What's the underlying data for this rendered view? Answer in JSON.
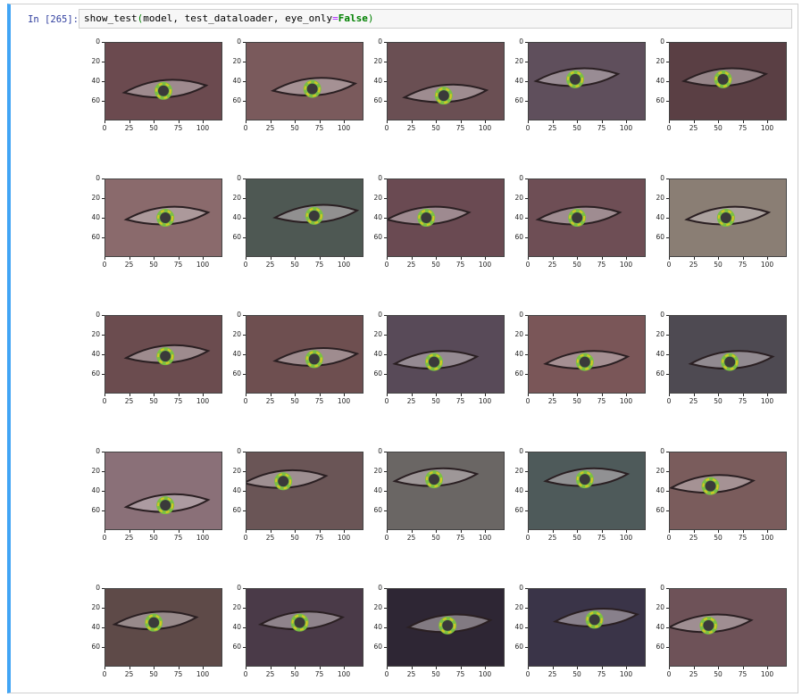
{
  "cell": {
    "prompt": "In [265]:",
    "code": {
      "fn": "show_test",
      "open": "(",
      "args": "model, test_dataloader, eye_only",
      "eq": "=",
      "kw": "False",
      "close": ")"
    }
  },
  "axes": {
    "yticks": [
      "0",
      "20",
      "40",
      "60"
    ],
    "xticks": [
      "0",
      "25",
      "50",
      "75",
      "100"
    ]
  },
  "grid": {
    "rows": 5,
    "cols": 5
  },
  "panels": [
    {
      "skin": "#6b4a4f",
      "pupil": [
        60,
        50
      ]
    },
    {
      "skin": "#7a5a5c",
      "pupil": [
        68,
        48
      ]
    },
    {
      "skin": "#6a4f53",
      "pupil": [
        58,
        55
      ]
    },
    {
      "skin": "#5f4f5c",
      "pupil": [
        48,
        38
      ]
    },
    {
      "skin": "#5a3f44",
      "pupil": [
        55,
        38
      ]
    },
    {
      "skin": "#8a6a6c",
      "pupil": [
        62,
        40
      ]
    },
    {
      "skin": "#4e5853",
      "pupil": [
        70,
        38
      ]
    },
    {
      "skin": "#6a4a52",
      "pupil": [
        40,
        40
      ]
    },
    {
      "skin": "#6e4e55",
      "pupil": [
        50,
        40
      ]
    },
    {
      "skin": "#8a7e74",
      "pupil": [
        58,
        40
      ]
    },
    {
      "skin": "#6b4c4f",
      "pupil": [
        62,
        42
      ]
    },
    {
      "skin": "#6e4f50",
      "pupil": [
        70,
        45
      ]
    },
    {
      "skin": "#584a58",
      "pupil": [
        48,
        48
      ]
    },
    {
      "skin": "#7a5658",
      "pupil": [
        58,
        48
      ]
    },
    {
      "skin": "#4e4a52",
      "pupil": [
        62,
        48
      ]
    },
    {
      "skin": "#8a7078",
      "pupil": [
        62,
        55
      ]
    },
    {
      "skin": "#6a5556",
      "pupil": [
        38,
        30
      ]
    },
    {
      "skin": "#6a6664",
      "pupil": [
        48,
        28
      ]
    },
    {
      "skin": "#4e5a5a",
      "pupil": [
        58,
        28
      ]
    },
    {
      "skin": "#7a5c5c",
      "pupil": [
        42,
        35
      ]
    },
    {
      "skin": "#5e4a48",
      "pupil": [
        50,
        35
      ]
    },
    {
      "skin": "#4a3a48",
      "pupil": [
        55,
        35
      ]
    },
    {
      "skin": "#2e2634",
      "pupil": [
        62,
        38
      ]
    },
    {
      "skin": "#3a3448",
      "pupil": [
        68,
        32
      ]
    },
    {
      "skin": "#6e5258",
      "pupil": [
        40,
        38
      ]
    }
  ]
}
